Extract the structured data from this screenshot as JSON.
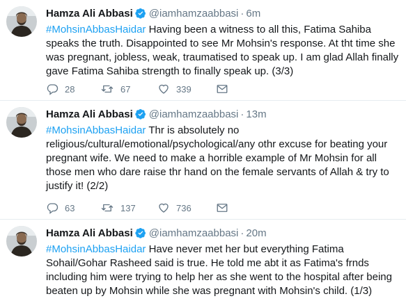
{
  "tweets": [
    {
      "author_name": "Hamza Ali Abbasi",
      "handle": "@iamhamzaabbasi",
      "separator": "·",
      "time": "6m",
      "hashtag": "#MohsinAbbasHaidar",
      "text": " Having been a witness to all this, Fatima Sahiba speaks the truth. Disappointed to see Mr Mohsin's response. At tht time she was pregnant, jobless, weak, traumatised to speak up. I am glad Allah finally gave Fatima Sahiba strength to finally speak up. (3/3)",
      "replies": "28",
      "retweets": "67",
      "likes": "339"
    },
    {
      "author_name": "Hamza Ali Abbasi",
      "handle": "@iamhamzaabbasi",
      "separator": "·",
      "time": "13m",
      "hashtag": "#MohsinAbbasHaidar",
      "text": " Thr is absolutely no religious/cultural/emotional/psychological/any othr excuse for beating your pregnant wife. We need to make a horrible example of Mr Mohsin for all those men who dare raise thr hand on the female servants of Allah & try to justify it! (2/2)",
      "replies": "63",
      "retweets": "137",
      "likes": "736"
    },
    {
      "author_name": "Hamza Ali Abbasi",
      "handle": "@iamhamzaabbasi",
      "separator": "·",
      "time": "20m",
      "hashtag": "#MohsinAbbasHaidar",
      "text": " Have never met her but everything Fatima Sohail/Gohar Rasheed said is true. He told me abt it as Fatima's frnds including him were trying to help her as she went to the hospital after being beaten up by Mohsin while she was pregnant with Mohsin's child. (1/3)"
    }
  ],
  "icons": {
    "reply": "reply-icon",
    "retweet": "retweet-icon",
    "like": "heart-icon",
    "dm": "envelope-icon",
    "verified": "verified-badge-icon"
  },
  "colors": {
    "accent": "#1da1f2",
    "muted": "#657786",
    "text": "#14171a",
    "divider": "#e6ecf0"
  }
}
